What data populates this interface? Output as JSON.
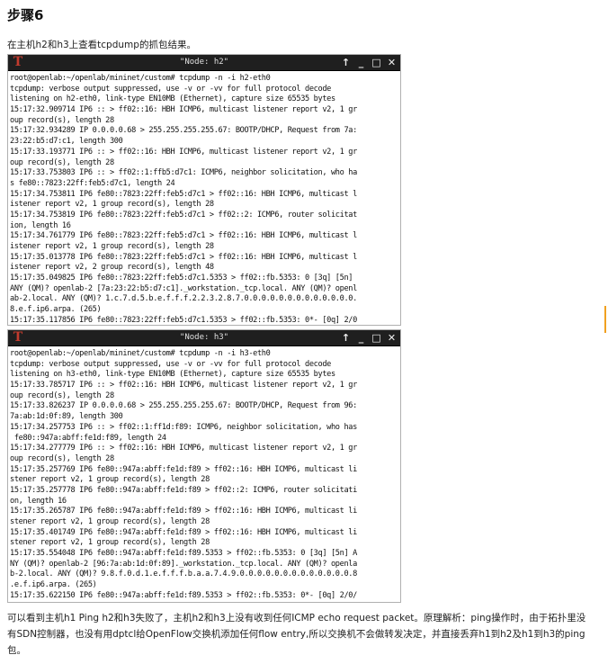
{
  "heading": "步骤6",
  "intro": "在主机h2和h3上查看tcpdump的抓包结果。",
  "terminals": [
    {
      "title": "\"Node: h2\"",
      "lines": [
        "root@openlab:~/openlab/mininet/custom# tcpdump -n -i h2-eth0",
        "tcpdump: verbose output suppressed, use -v or -vv for full protocol decode",
        "listening on h2-eth0, link-type EN10MB (Ethernet), capture size 65535 bytes",
        "15:17:32.909714 IP6 :: > ff02::16: HBH ICMP6, multicast listener report v2, 1 gr",
        "oup record(s), length 28",
        "15:17:32.934289 IP 0.0.0.0.68 > 255.255.255.255.67: BOOTP/DHCP, Request from 7a:",
        "23:22:b5:d7:c1, length 300",
        "15:17:33.193771 IP6 :: > ff02::16: HBH ICMP6, multicast listener report v2, 1 gr",
        "oup record(s), length 28",
        "15:17:33.753803 IP6 :: > ff02::1:ffb5:d7c1: ICMP6, neighbor solicitation, who ha",
        "s fe80::7823:22ff:feb5:d7c1, length 24",
        "15:17:34.753811 IP6 fe80::7823:22ff:feb5:d7c1 > ff02::16: HBH ICMP6, multicast l",
        "istener report v2, 1 group record(s), length 28",
        "15:17:34.753819 IP6 fe80::7823:22ff:feb5:d7c1 > ff02::2: ICMP6, router solicitat",
        "ion, length 16",
        "15:17:34.761779 IP6 fe80::7823:22ff:feb5:d7c1 > ff02::16: HBH ICMP6, multicast l",
        "istener report v2, 1 group record(s), length 28",
        "15:17:35.013778 IP6 fe80::7823:22ff:feb5:d7c1 > ff02::16: HBH ICMP6, multicast l",
        "istener report v2, 2 group record(s), length 48",
        "15:17:35.049825 IP6 fe80::7823:22ff:feb5:d7c1.5353 > ff02::fb.5353: 0 [3q] [5n]",
        "ANY (QM)? openlab-2 [7a:23:22:b5:d7:c1]._workstation._tcp.local. ANY (QM)? openl",
        "ab-2.local. ANY (QM)? 1.c.7.d.5.b.e.f.f.f.2.2.3.2.8.7.0.0.0.0.0.0.0.0.0.0.0.0.0.",
        "8.e.f.ip6.arpa. (265)",
        "15:17:35.117856 IP6 fe80::7823:22ff:feb5:d7c1.5353 > ff02::fb.5353: 0*- [0q] 2/0"
      ]
    },
    {
      "title": "\"Node: h3\"",
      "lines": [
        "root@openlab:~/openlab/mininet/custom# tcpdump -n -i h3-eth0",
        "tcpdump: verbose output suppressed, use -v or -vv for full protocol decode",
        "listening on h3-eth0, link-type EN10MB (Ethernet), capture size 65535 bytes",
        "15:17:33.785717 IP6 :: > ff02::16: HBH ICMP6, multicast listener report v2, 1 gr",
        "oup record(s), length 28",
        "15:17:33.826237 IP 0.0.0.0.68 > 255.255.255.255.67: BOOTP/DHCP, Request from 96:",
        "7a:ab:1d:0f:89, length 300",
        "15:17:34.257753 IP6 :: > ff02::1:ff1d:f89: ICMP6, neighbor solicitation, who has",
        " fe80::947a:abff:fe1d:f89, length 24",
        "15:17:34.277779 IP6 :: > ff02::16: HBH ICMP6, multicast listener report v2, 1 gr",
        "oup record(s), length 28",
        "15:17:35.257769 IP6 fe80::947a:abff:fe1d:f89 > ff02::16: HBH ICMP6, multicast li",
        "stener report v2, 1 group record(s), length 28",
        "15:17:35.257778 IP6 fe80::947a:abff:fe1d:f89 > ff02::2: ICMP6, router solicitati",
        "on, length 16",
        "15:17:35.265787 IP6 fe80::947a:abff:fe1d:f89 > ff02::16: HBH ICMP6, multicast li",
        "stener report v2, 1 group record(s), length 28",
        "15:17:35.401749 IP6 fe80::947a:abff:fe1d:f89 > ff02::16: HBH ICMP6, multicast li",
        "stener report v2, 1 group record(s), length 28",
        "15:17:35.554048 IP6 fe80::947a:abff:fe1d:f89.5353 > ff02::fb.5353: 0 [3q] [5n] A",
        "NY (QM)? openlab-2 [96:7a:ab:1d:0f:89]._workstation._tcp.local. ANY (QM)? openla",
        "b-2.local. ANY (QM)? 9.8.f.0.d.1.e.f.f.f.b.a.a.7.4.9.0.0.0.0.0.0.0.0.0.0.0.0.0.8",
        ".e.f.ip6.arpa. (265)",
        "15:17:35.622150 IP6 fe80::947a:abff:fe1d:f89.5353 > ff02::fb.5353: 0*- [0q] 2/0/"
      ]
    }
  ],
  "window_buttons": {
    "up": "↑",
    "minimize": "_",
    "maximize": "□",
    "close": "✕"
  },
  "logo_letter": "T",
  "summary": "可以看到主机h1 Ping h2和h3失败了，主机h2和h3上没有收到任何ICMP echo request packet。原理解析：ping操作时，由于拓扑里没有SDN控制器，也没有用dptcl给OpenFlow交换机添加任何flow entry,所以交换机不会做转发决定，并直接丢弃h1到h2及h1到h3的ping包。"
}
